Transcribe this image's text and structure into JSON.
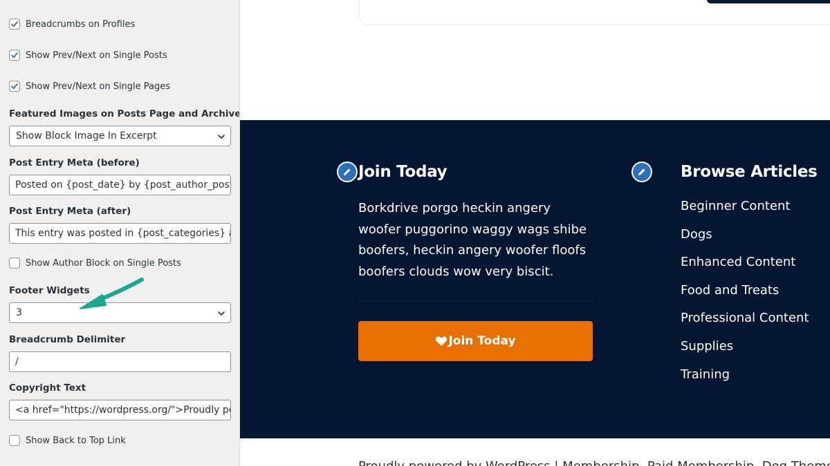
{
  "sidebar": {
    "checkboxes": {
      "breadcrumbs_profiles": {
        "label": "Breadcrumbs on Profiles",
        "checked": true
      },
      "prevnext_posts": {
        "label": "Show Prev/Next on Single Posts",
        "checked": true
      },
      "prevnext_pages": {
        "label": "Show Prev/Next on Single Pages",
        "checked": true
      },
      "author_block": {
        "label": "Show Author Block on Single Posts",
        "checked": false
      },
      "back_to_top": {
        "label": "Show Back to Top Link",
        "checked": false
      }
    },
    "featured_images": {
      "label": "Featured Images on Posts Page and Archives",
      "value": "Show Block Image In Excerpt"
    },
    "meta_before": {
      "label": "Post Entry Meta (before)",
      "value": "Posted on {post_date} by {post_author_posts_link}"
    },
    "meta_after": {
      "label": "Post Entry Meta (after)",
      "value": "This entry was posted in {post_categories} and tagged {post_tags}"
    },
    "footer_widgets": {
      "label": "Footer Widgets",
      "value": "3"
    },
    "breadcrumb_delimiter": {
      "label": "Breadcrumb Delimiter",
      "value": "/"
    },
    "copyright": {
      "label": "Copyright Text",
      "value": "<a href=\"https://wordpress.org/\">Proudly powered by WordPress</a>"
    }
  },
  "annotation": {
    "arrow_color": "#1aa88f"
  },
  "preview": {
    "join_widget": {
      "title": "Join Today",
      "text": "Borkdrive porgo heckin angery woofer puggorino waggy wags shibe boofers, heckin angery woofer floofs boofers clouds wow very biscit.",
      "button_label": "Join Today"
    },
    "browse_widget": {
      "title": "Browse Articles",
      "articles": [
        "Beginner Content",
        "Dogs",
        "Enhanced Content",
        "Food and Treats",
        "Professional Content",
        "Supplies",
        "Training"
      ]
    },
    "footer_credit": "Proudly powered by WordPress | Membership, Paid Membership, Dog Theme",
    "colors": {
      "footer_bg": "#041631",
      "button_bg": "#e87000",
      "pencil_bg": "#2f6fb8",
      "checkbox_accent": "#2271b1"
    }
  }
}
